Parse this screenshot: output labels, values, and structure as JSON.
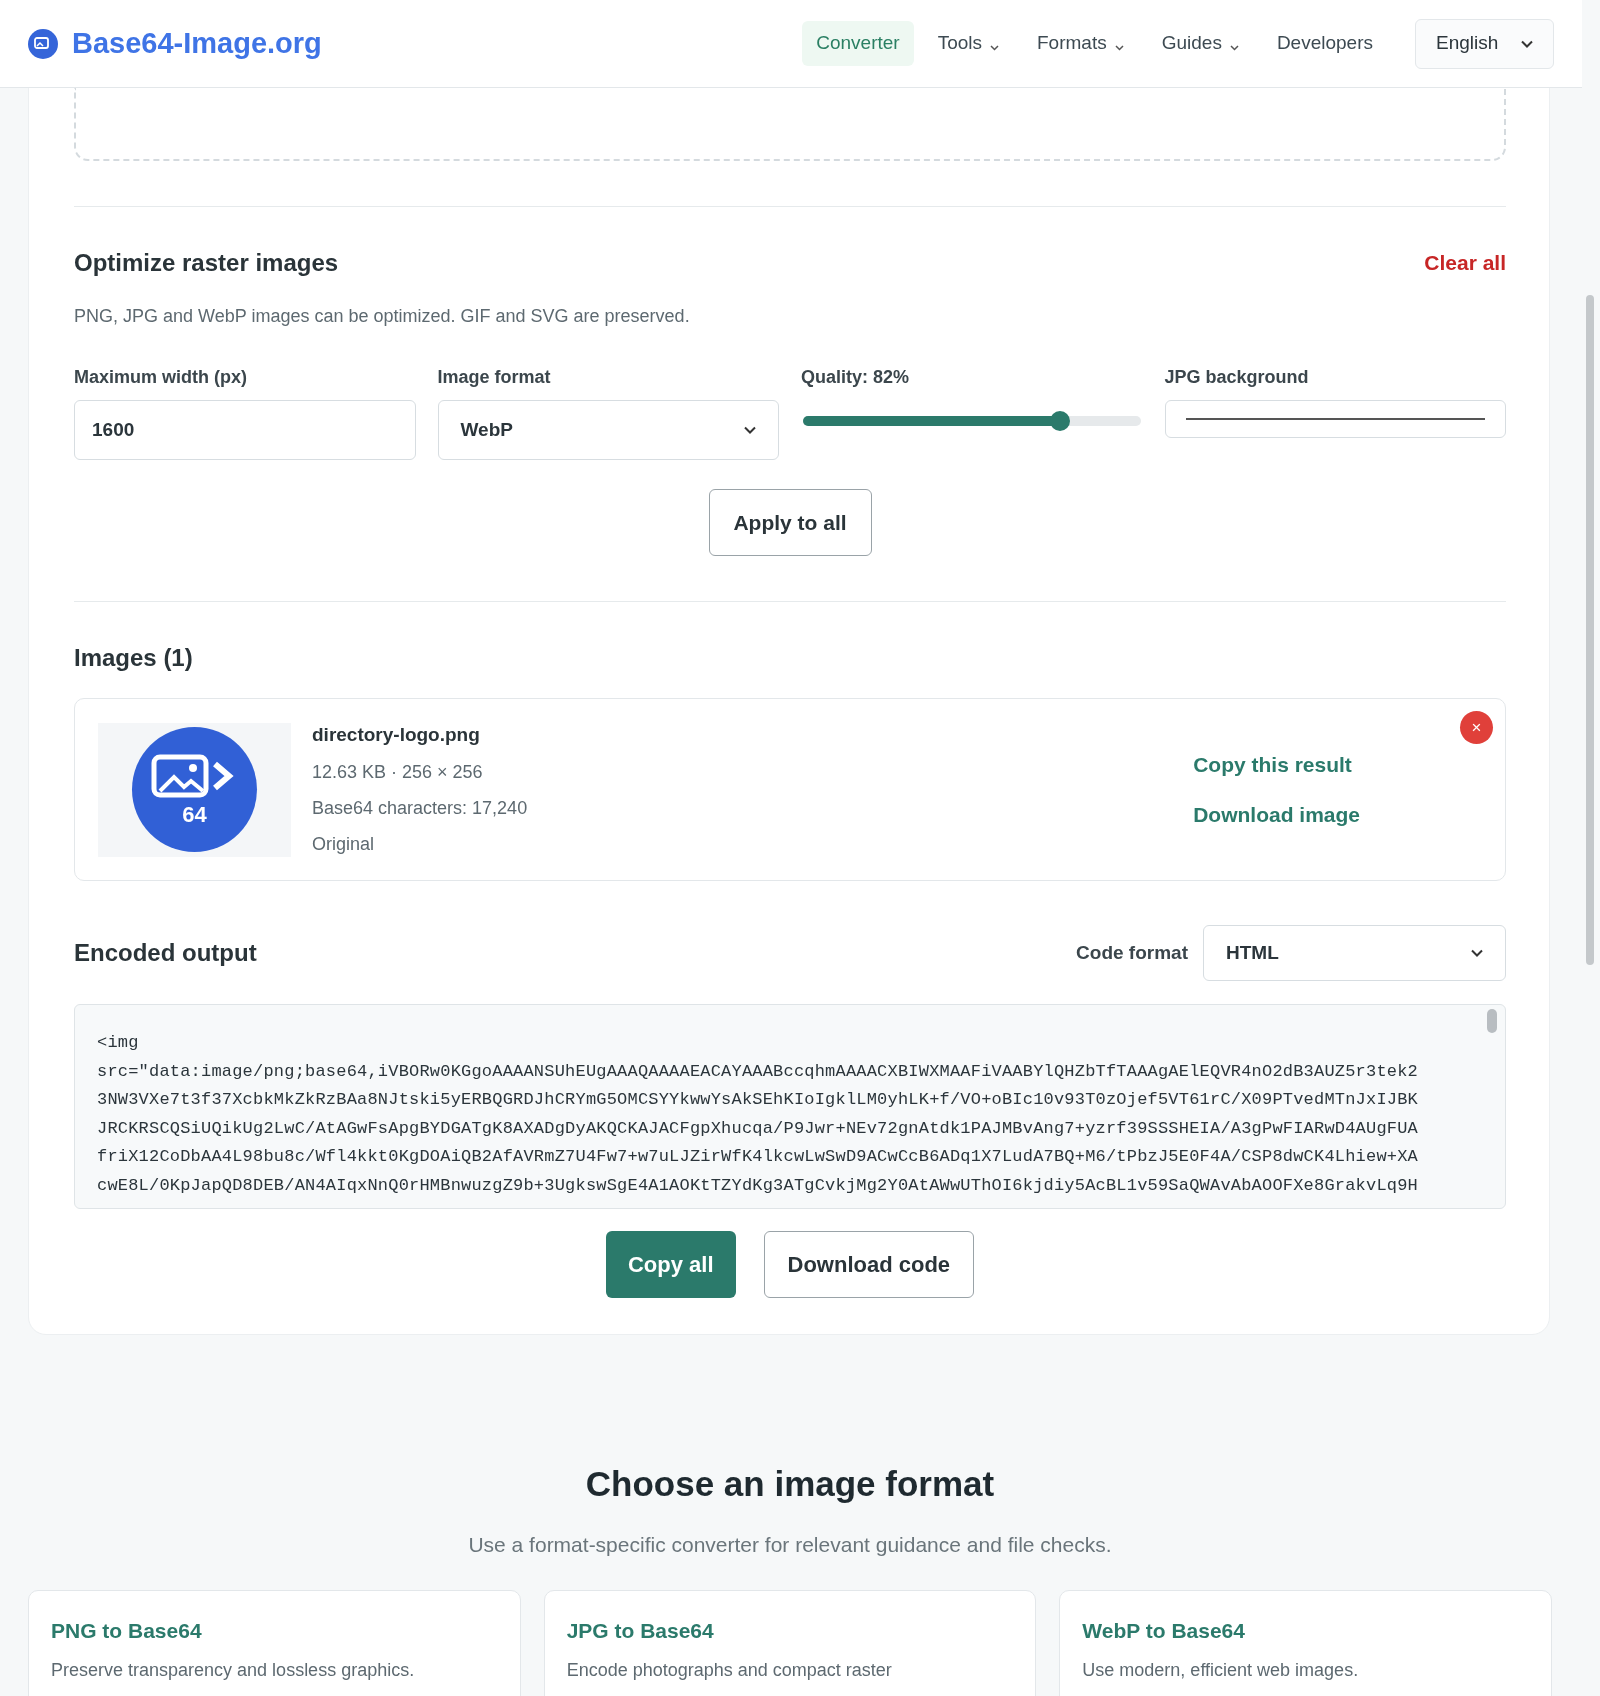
{
  "header": {
    "logo": "Base64-Image.org",
    "nav": [
      {
        "label": "Converter",
        "selected": true,
        "dropdown": false
      },
      {
        "label": "Tools",
        "selected": false,
        "dropdown": true
      },
      {
        "label": "Formats",
        "selected": false,
        "dropdown": true
      },
      {
        "label": "Guides",
        "selected": false,
        "dropdown": true
      },
      {
        "label": "Developers",
        "selected": false,
        "dropdown": false
      }
    ],
    "language": "English"
  },
  "optimize": {
    "title": "Optimize raster images",
    "clear": "Clear all",
    "description": "PNG, JPG and WebP images can be optimized. GIF and SVG are preserved.",
    "fields": [
      {
        "kind": "input",
        "label": "Maximum width (px)",
        "value": "1600"
      },
      {
        "kind": "select",
        "label": "Image format",
        "value": "WebP"
      },
      {
        "kind": "slider",
        "label": "Quality: 82%",
        "level": 0.76
      },
      {
        "kind": "color",
        "label": "JPG background"
      }
    ],
    "apply": "Apply to all"
  },
  "images": {
    "title": "Images (1)",
    "items": [
      {
        "name": "directory-logo.png",
        "thumb_text": "64",
        "meta": [
          "12.63 KB · 256 × 256",
          "Base64 characters: 17,240",
          "Original"
        ],
        "actions": [
          "Copy this result",
          "Download image"
        ],
        "remove": "×"
      }
    ]
  },
  "output": {
    "title": "Encoded output",
    "code_format_label": "Code format",
    "code_format": "HTML",
    "lines": [
      "<img",
      "src=\"data:image/png;base64,iVBORw0KGgoAAAANSUhEUgAAAQAAAAEACAYAAABccqhmAAAACXBIWXMAAFiVAABYlQHZbTfTAAAgAElEQVR4nO2dB3AUZ5r3tek2",
      "3NW3VXe7t3f37XcbkMkZkRzBAa8NJtski5yERBQGRDJhCRYmG5OMCSYYkwwYsAkSEhKIoIgklLM0yhLK+f/VO+oBIc10v93T0zOjef5VT61rC/X09PTvedMTnJxIJBK",
      "JRCKRSCQSiUQikUg2LwC/AtAGwFsApgBYDGATgK8AXADgDyAKQCKAJACFgpXhucqa/P9Jwr+NEv72gnAtdk1PAJMBvAng7+yzrf39SSSHEIA/A3gPwFIARwD4AUgFUA",
      "friX12CoDbAA4L98bu8c/Wfl4kkt0KgDOAiQB2AfAVRmZ7U4Fw7+w7uLJZirWfK4lkcwLwSwD9ACwCcB6ADq1X7LudA7BQ+M6/tPbzJ5E0F4A/CSP8dwCK4Lhiew+XA",
      "cwE8L/0KpJapQD8DEB/AN4AIqxNnQ0rHMBnwuzgZ9b+3UgkswSgE4A1AOKtTZYdKg3ATgCvkjMg2Y0AtAWwUThOI6kjdiy5AcBL1v59SaQWAvAbAOOFXe8GrakvLq9H"
    ],
    "buttons": [
      {
        "label": "Copy all",
        "primary": true
      },
      {
        "label": "Download code",
        "primary": false
      }
    ]
  },
  "formats": {
    "title": "Choose an image format",
    "subtitle": "Use a format-specific converter for relevant guidance and file checks.",
    "cards": [
      {
        "title": "PNG to Base64",
        "text": "Preserve transparency and lossless graphics."
      },
      {
        "title": "JPG to Base64",
        "text": "Encode photographs and compact raster"
      },
      {
        "title": "WebP to Base64",
        "text": "Use modern, efficient web images."
      }
    ]
  }
}
